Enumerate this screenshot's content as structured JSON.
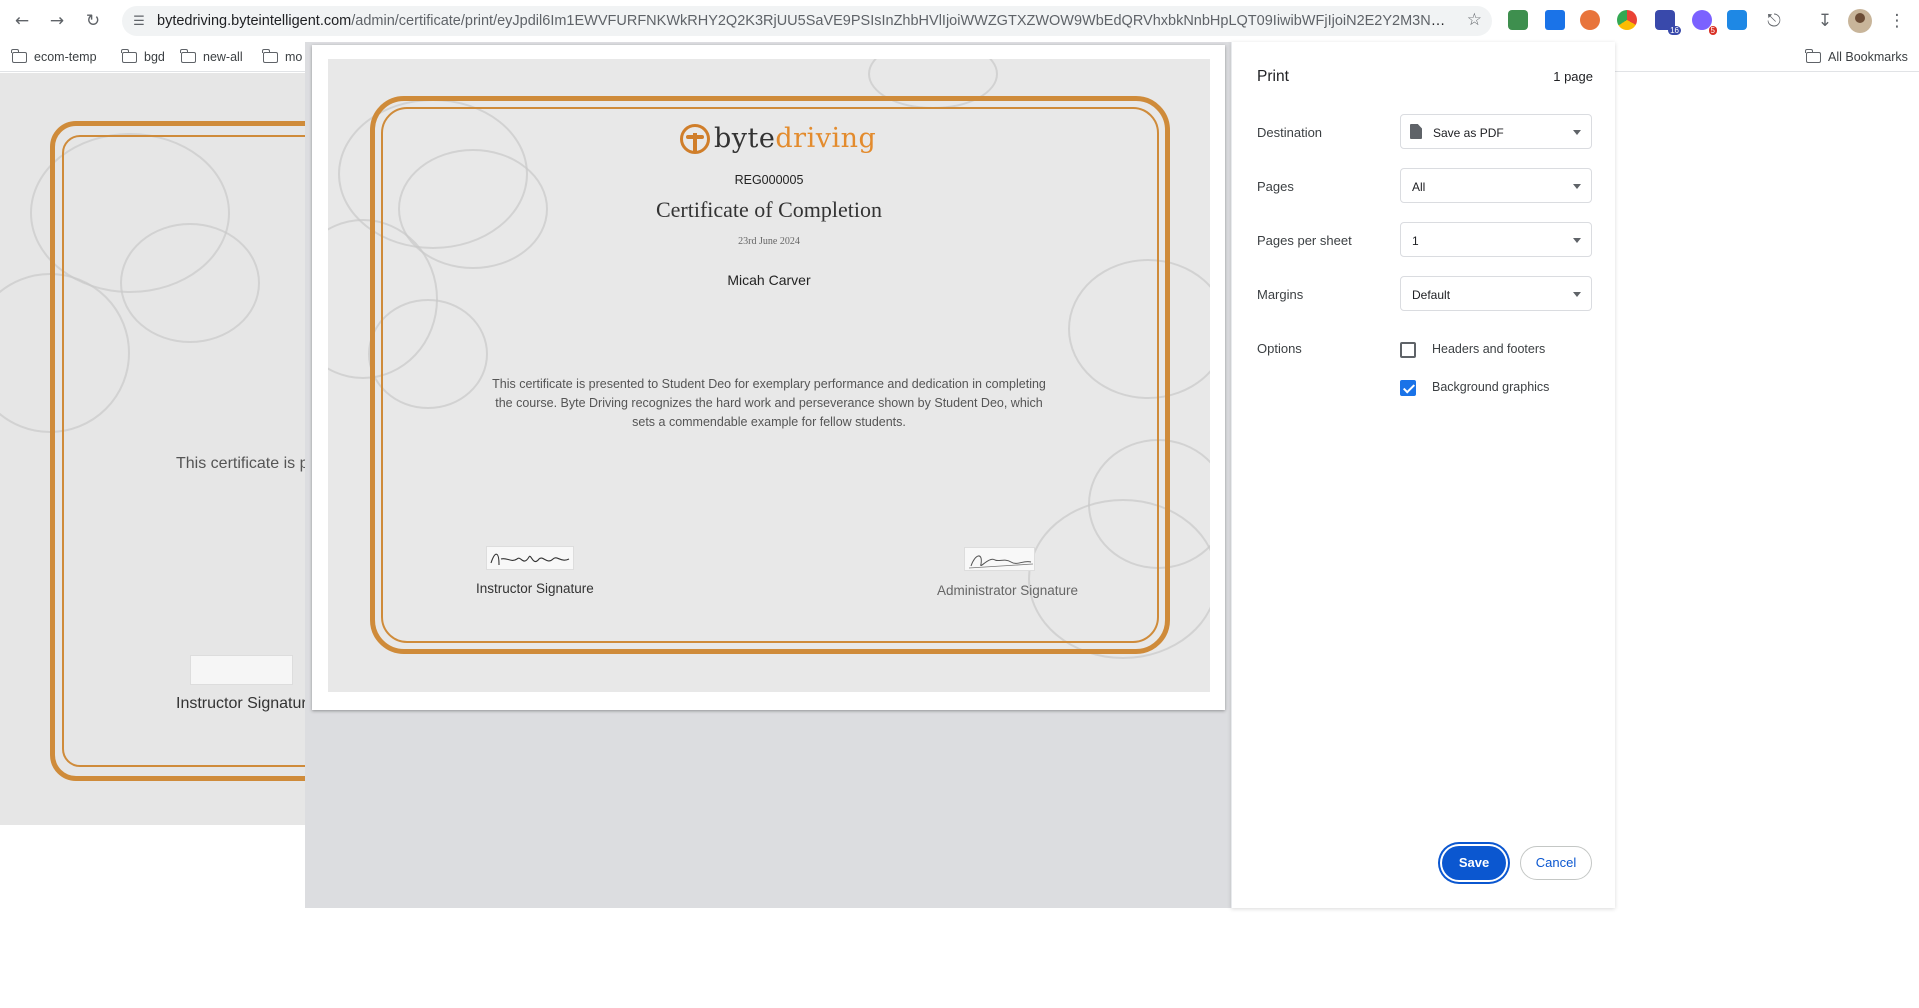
{
  "browser": {
    "url_host": "bytedriving.byteintelligent.com",
    "url_path": "/admin/certificate/print/eyJpdil6Im1EWVFURFNKWkRHY2Q2K3RjUU5SaVE9PSIsInZhbHVlIjoiWWZGTXZWOW9WbEdQRVhxbkNnbHpLQT09IiwibWFjIjoiN2E2Y2M3NjNhYzhjZDJhN...",
    "extension_badges": {
      "ext1": "16",
      "ext2": "5"
    },
    "bookmarks": [
      "ecom-temp",
      "bgd",
      "new-all",
      "mo"
    ],
    "all_bookmarks": "All Bookmarks"
  },
  "background_page": {
    "body_text": "This certificate is presented to Student Deo for exemplary performance and dedication in completing the course. Byte Driving recognizes the hard work",
    "instructor_label": "Instructor Signature"
  },
  "certificate": {
    "logo_part1": "byte",
    "logo_part2": "driving",
    "reg_no": "REG000005",
    "title": "Certificate of Completion",
    "date": "23rd June 2024",
    "recipient": "Micah Carver",
    "body": "This certificate is presented to Student Deo for exemplary performance and dedication in completing the course. Byte Driving recognizes the hard work and perseverance shown by Student Deo, which sets a commendable example for fellow students.",
    "instructor_label": "Instructor Signature",
    "admin_label": "Administrator Signature",
    "accent_color": "#cf8b3a"
  },
  "print_settings": {
    "title": "Print",
    "page_count": "1 page",
    "destination_label": "Destination",
    "destination_value": "Save as PDF",
    "pages_label": "Pages",
    "pages_value": "All",
    "pps_label": "Pages per sheet",
    "pps_value": "1",
    "margins_label": "Margins",
    "margins_value": "Default",
    "options_label": "Options",
    "headers_footers_label": "Headers and footers",
    "headers_footers_checked": false,
    "background_graphics_label": "Background graphics",
    "background_graphics_checked": true,
    "save_label": "Save",
    "cancel_label": "Cancel",
    "accent_color": "#0b57d0"
  }
}
